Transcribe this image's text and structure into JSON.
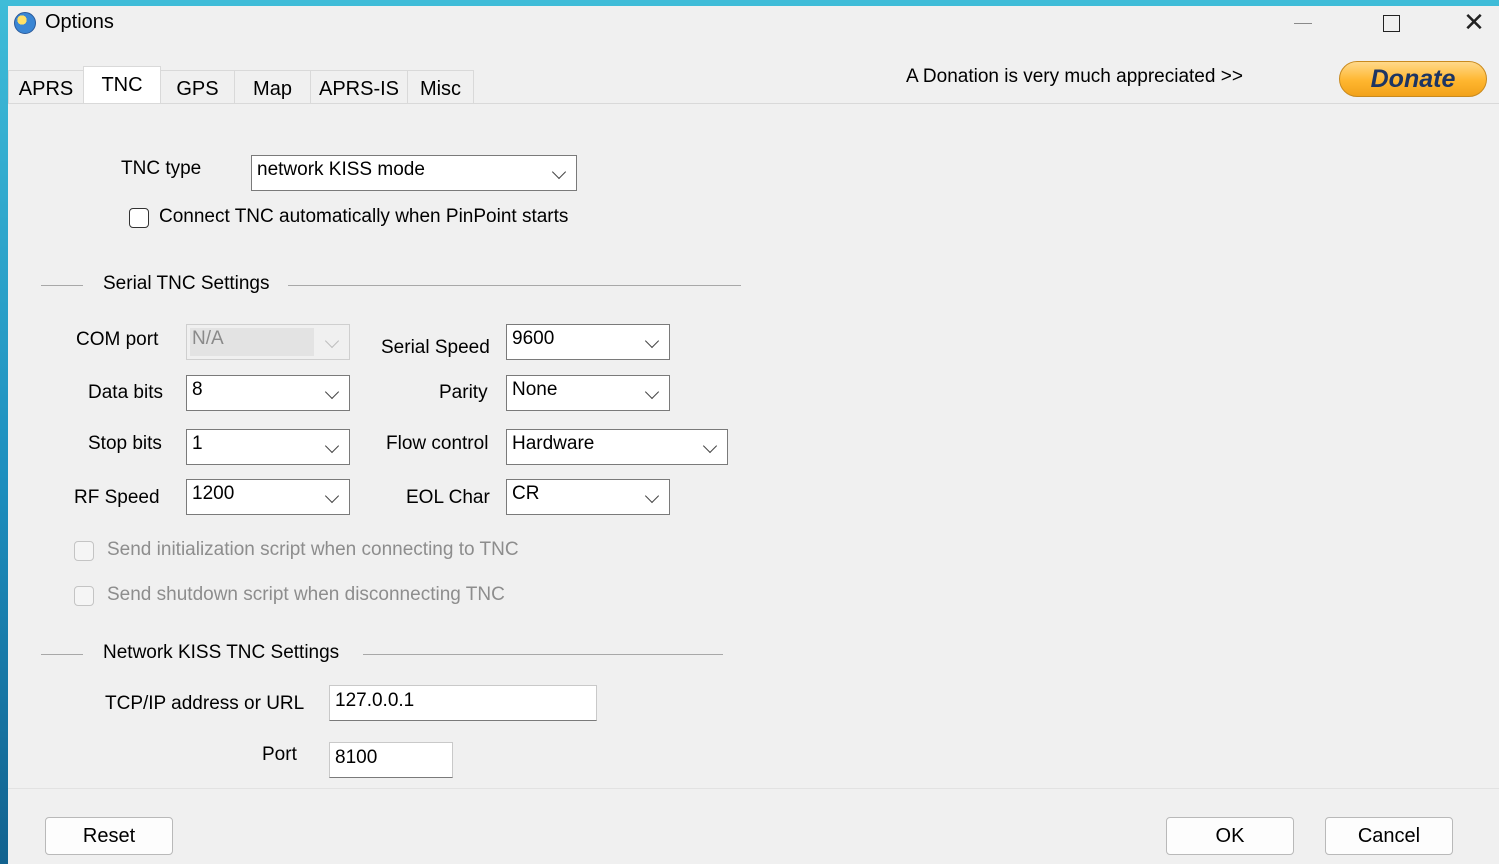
{
  "window": {
    "title": "Options",
    "minimize_icon": "minimize-icon",
    "maximize_icon": "maximize-icon",
    "close_icon": "close-icon"
  },
  "tabs": [
    {
      "label": "APRS",
      "active": false
    },
    {
      "label": "TNC",
      "active": true
    },
    {
      "label": "GPS",
      "active": false
    },
    {
      "label": "Map",
      "active": false
    },
    {
      "label": "APRS-IS",
      "active": false
    },
    {
      "label": "Misc",
      "active": false
    }
  ],
  "donation": {
    "text": "A Donation is very much appreciated >>",
    "button_label": "Donate"
  },
  "tnc": {
    "type_label": "TNC type",
    "type_value": "network KISS mode",
    "auto_connect_label": "Connect TNC automatically when PinPoint starts",
    "auto_connect_checked": false
  },
  "serial": {
    "group_label": "Serial TNC Settings",
    "com_port_label": "COM port",
    "com_port_value": "N/A",
    "serial_speed_label": "Serial Speed",
    "serial_speed_value": "9600",
    "data_bits_label": "Data bits",
    "data_bits_value": "8",
    "parity_label": "Parity",
    "parity_value": "None",
    "stop_bits_label": "Stop bits",
    "stop_bits_value": "1",
    "flow_control_label": "Flow control",
    "flow_control_value": "Hardware",
    "rf_speed_label": "RF Speed",
    "rf_speed_value": "1200",
    "eol_char_label": "EOL Char",
    "eol_char_value": "CR",
    "init_script_label": "Send initialization script when connecting to TNC",
    "shutdown_script_label": "Send shutdown script when disconnecting TNC"
  },
  "network": {
    "group_label": "Network KISS TNC Settings",
    "address_label": "TCP/IP address or URL",
    "address_value": "127.0.0.1",
    "port_label": "Port",
    "port_value": "8100"
  },
  "buttons": {
    "reset": "Reset",
    "ok": "OK",
    "cancel": "Cancel"
  }
}
